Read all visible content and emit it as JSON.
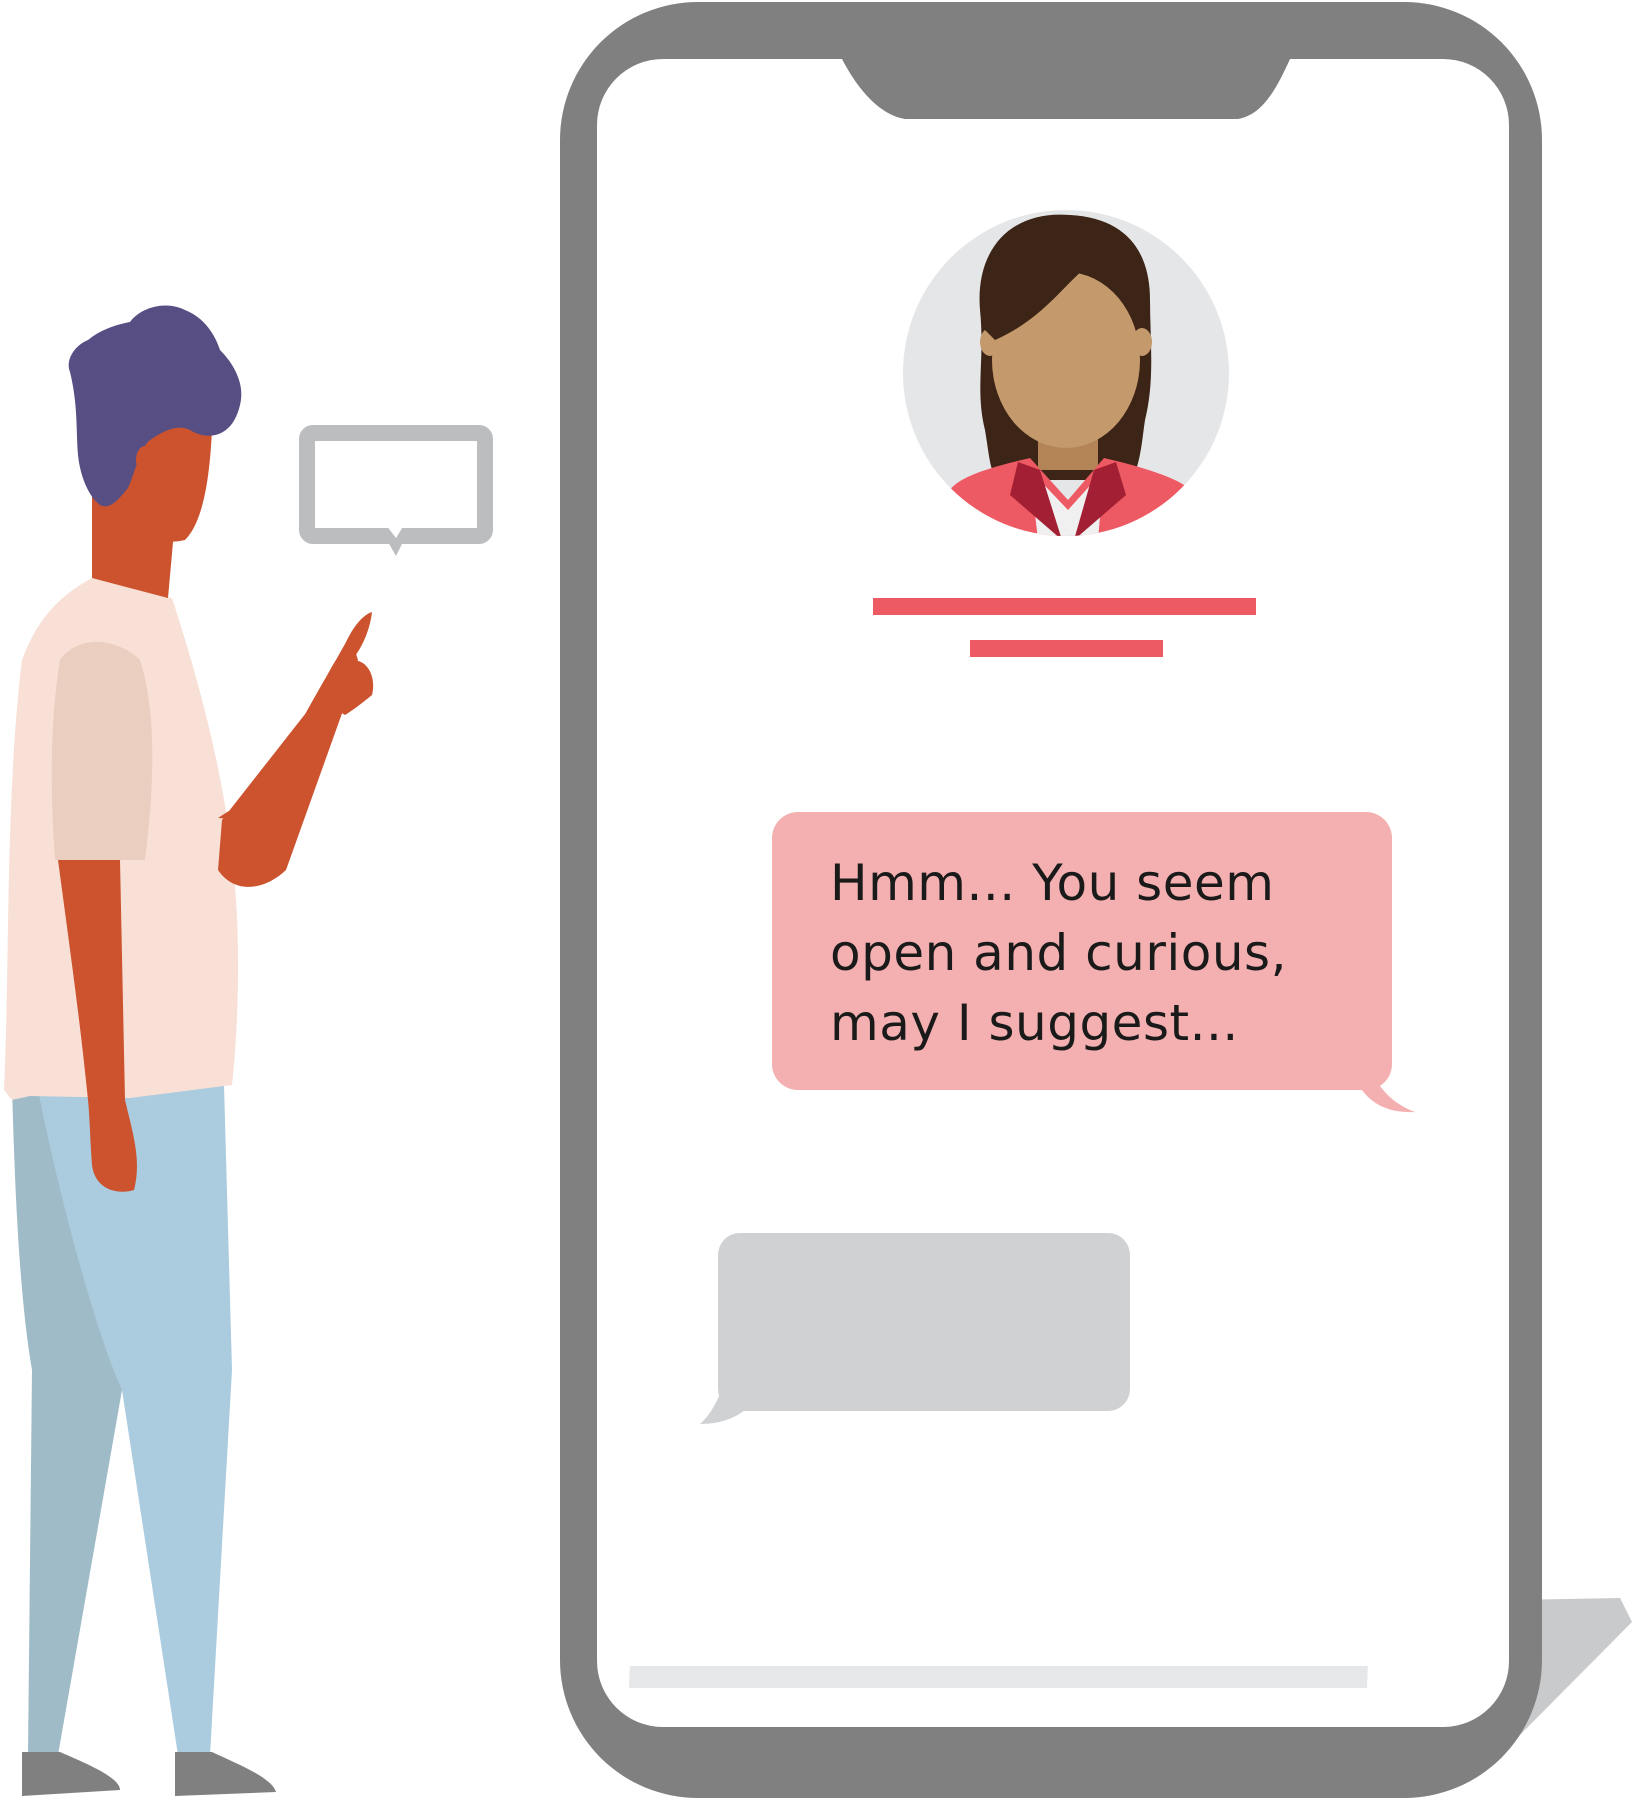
{
  "chat": {
    "bot_message_lines": [
      "Hmm... You seem",
      "open and curious,",
      "may I suggest..."
    ]
  },
  "colors": {
    "phone_frame": "#7f807f",
    "phone_screen": "#ffffff",
    "bot_bubble": "#f4b0b0",
    "user_bubble": "#d0d1d3",
    "accent_lines": "#ee5a63",
    "avatar_background": "#e5e6e8",
    "man_skin": "#cc532e",
    "man_hair": "#574f83",
    "man_shirt": "#f8e0d6",
    "man_pants": "#abcbde",
    "woman_skin": "#c49a6c",
    "woman_hair": "#3c2416"
  },
  "icons": {
    "avatar": "woman-avatar-icon",
    "speech": "speech-bubble-icon"
  }
}
